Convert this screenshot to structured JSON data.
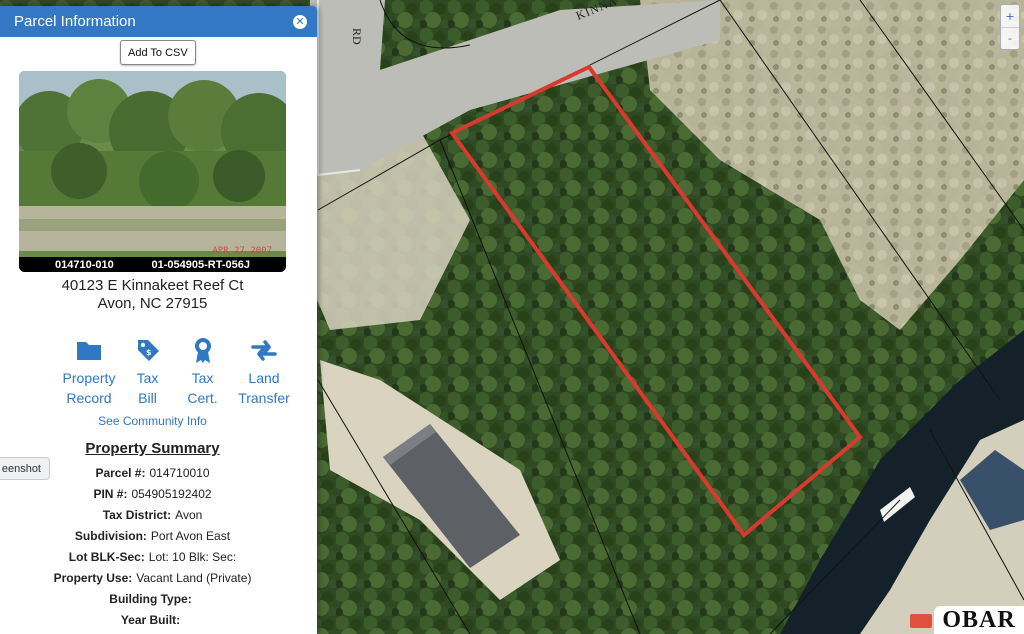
{
  "panel": {
    "title": "Parcel Information",
    "close_icon": "close-icon",
    "add_csv_label": "Add To CSV",
    "photo": {
      "left_id": "014710-010",
      "right_id": "01-054905-RT-056J",
      "date_stamp": "APR 27 2007"
    },
    "address_line1": "40123 E Kinnakeet Reef Ct",
    "address_line2": "Avon, NC 27915",
    "actions": [
      {
        "line1": "Property",
        "line2": "Record",
        "icon": "folder-icon"
      },
      {
        "line1": "Tax",
        "line2": "Bill",
        "icon": "tag-icon"
      },
      {
        "line1": "Tax",
        "line2": "Cert.",
        "icon": "certificate-icon"
      },
      {
        "line1": "Land",
        "line2": "Transfer",
        "icon": "transfer-arrows-icon"
      }
    ],
    "community_link": "See Community Info",
    "summary_title": "Property Summary",
    "summary": [
      {
        "key": "Parcel #:",
        "value": "014710010"
      },
      {
        "key": "PIN #:",
        "value": "054905192402"
      },
      {
        "key": "Tax District:",
        "value": "Avon"
      },
      {
        "key": "Subdivision:",
        "value": "Port Avon East"
      },
      {
        "key": "Lot BLK-Sec:",
        "value": "Lot: 10 Blk: Sec:"
      },
      {
        "key": "Property Use:",
        "value": "Vacant Land (Private)"
      },
      {
        "key": "Building Type:",
        "value": ""
      },
      {
        "key": "Year Built:",
        "value": ""
      }
    ],
    "screenshot_label": "eenshot"
  },
  "map": {
    "road_label_rd": "RD",
    "road_label_kinna": "KINNA",
    "zoom_in": "+",
    "zoom_out": "-",
    "logo": "OBAR",
    "parcel_outline_color": "#d9392f"
  },
  "colors": {
    "header": "#3478c5",
    "link": "#2f78c2"
  }
}
